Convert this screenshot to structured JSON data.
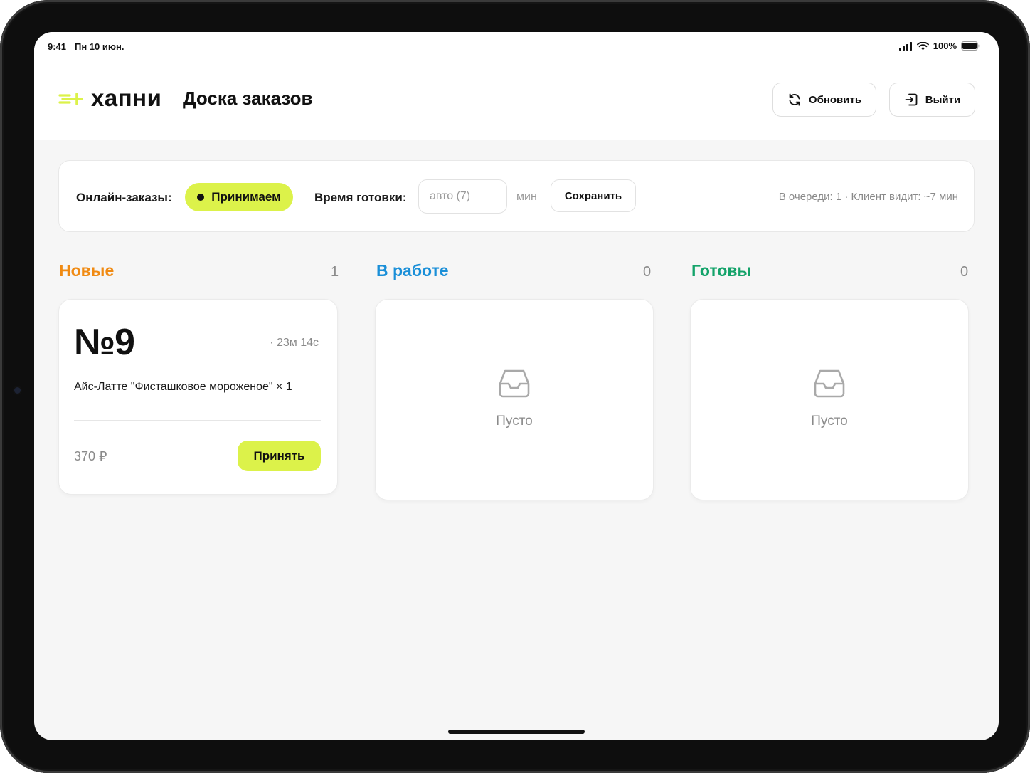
{
  "status_bar": {
    "time": "9:41",
    "date": "Пн 10 июн.",
    "battery": "100%"
  },
  "header": {
    "brand": "хапни",
    "title": "Доска заказов",
    "refresh_label": "Обновить",
    "logout_label": "Выйти",
    "brand_color": "#dcf24a"
  },
  "controls": {
    "online_label": "Онлайн-заказы:",
    "online_status": "Принимаем",
    "prep_time_label": "Время готовки:",
    "prep_time_placeholder": "авто (7)",
    "prep_time_unit": "мин",
    "save_label": "Сохранить",
    "queue_info": "В очереди: 1 · Клиент видит: ~7 мин"
  },
  "columns": [
    {
      "title": "Новые",
      "count": "1",
      "color": "#f08a12"
    },
    {
      "title": "В работе",
      "count": "0",
      "color": "#1a8fd8"
    },
    {
      "title": "Готовы",
      "count": "0",
      "color": "#14a36a"
    }
  ],
  "orders": [
    {
      "number": "№9",
      "elapsed": "· 23м 14с",
      "item": "Айс-Латте \"Фисташковое мороженое\" × 1",
      "price": "370 ₽",
      "action_label": "Принять"
    }
  ],
  "empty_state": {
    "label": "Пусто",
    "icon": "inbox-tray-icon"
  }
}
